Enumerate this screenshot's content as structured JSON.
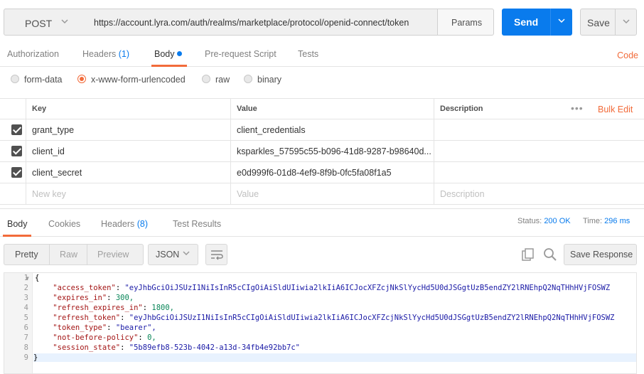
{
  "request": {
    "method": "POST",
    "url": "https://account.lyra.com/auth/realms/marketplace/protocol/openid-connect/token",
    "params_label": "Params",
    "send_label": "Send",
    "save_label": "Save"
  },
  "request_tabs": {
    "authorization": "Authorization",
    "headers": "Headers",
    "headers_count": "(1)",
    "body": "Body",
    "prerequest": "Pre-request Script",
    "tests": "Tests",
    "code": "Code"
  },
  "body_types": {
    "form_data": "form-data",
    "urlencoded": "x-www-form-urlencoded",
    "raw": "raw",
    "binary": "binary",
    "selected": "x-www-form-urlencoded"
  },
  "params_table": {
    "headers": {
      "key": "Key",
      "value": "Value",
      "description": "Description",
      "bulk_edit": "Bulk Edit"
    },
    "rows": [
      {
        "key": "grant_type",
        "value": "client_credentials",
        "description": "",
        "checked": true
      },
      {
        "key": "client_id",
        "value": "ksparkles_57595c55-b096-41d8-9287-b98640d...",
        "description": "",
        "checked": true
      },
      {
        "key": "client_secret",
        "value": "e0d999f6-01d8-4ef9-8f9b-0fc5fa08f1a5",
        "description": "",
        "checked": true
      }
    ],
    "placeholders": {
      "key": "New key",
      "value": "Value",
      "description": "Description"
    }
  },
  "response_tabs": {
    "body": "Body",
    "cookies": "Cookies",
    "headers": "Headers",
    "headers_count": "(8)",
    "tests": "Test Results",
    "status_label": "Status:",
    "status_value": "200 OK",
    "time_label": "Time:",
    "time_value": "296 ms"
  },
  "response_toolbar": {
    "pretty": "Pretty",
    "raw": "Raw",
    "preview": "Preview",
    "format": "JSON",
    "save_response": "Save Response"
  },
  "response_body": {
    "line_numbers": [
      "1",
      "2",
      "3",
      "4",
      "5",
      "6",
      "7",
      "8",
      "9"
    ],
    "open_brace": "{",
    "close_brace": "}",
    "lines": [
      {
        "key": "\"access_token\"",
        "value": "\"eyJhbGciOiJSUzI1NiIsInR5cCIgOiAiSldUIiwia2lkIiA6ICJocXFZcjNkSlYycHd5U0dJSGgtUzB5endZY2lRNEhpQ2NqTHhHVjFOSWZ"
      },
      {
        "key": "\"expires_in\"",
        "value": "300,"
      },
      {
        "key": "\"refresh_expires_in\"",
        "value": "1800,"
      },
      {
        "key": "\"refresh_token\"",
        "value": "\"eyJhbGciOiJSUzI1NiIsInR5cCIgOiAiSldUIiwia2lkIiA6ICJocXFZcjNkSlYycHd5U0dJSGgtUzB5endZY2lRNEhpQ2NqTHhHVjFOSWZ"
      },
      {
        "key": "\"token_type\"",
        "value": "\"bearer\","
      },
      {
        "key": "\"not-before-policy\"",
        "value": "0,"
      },
      {
        "key": "\"session_state\"",
        "value": "\"5b89efb8-523b-4042-a13d-34fb4e92bb7c\""
      }
    ]
  },
  "colors": {
    "accent": "#f26b3a",
    "primary": "#097bed"
  }
}
